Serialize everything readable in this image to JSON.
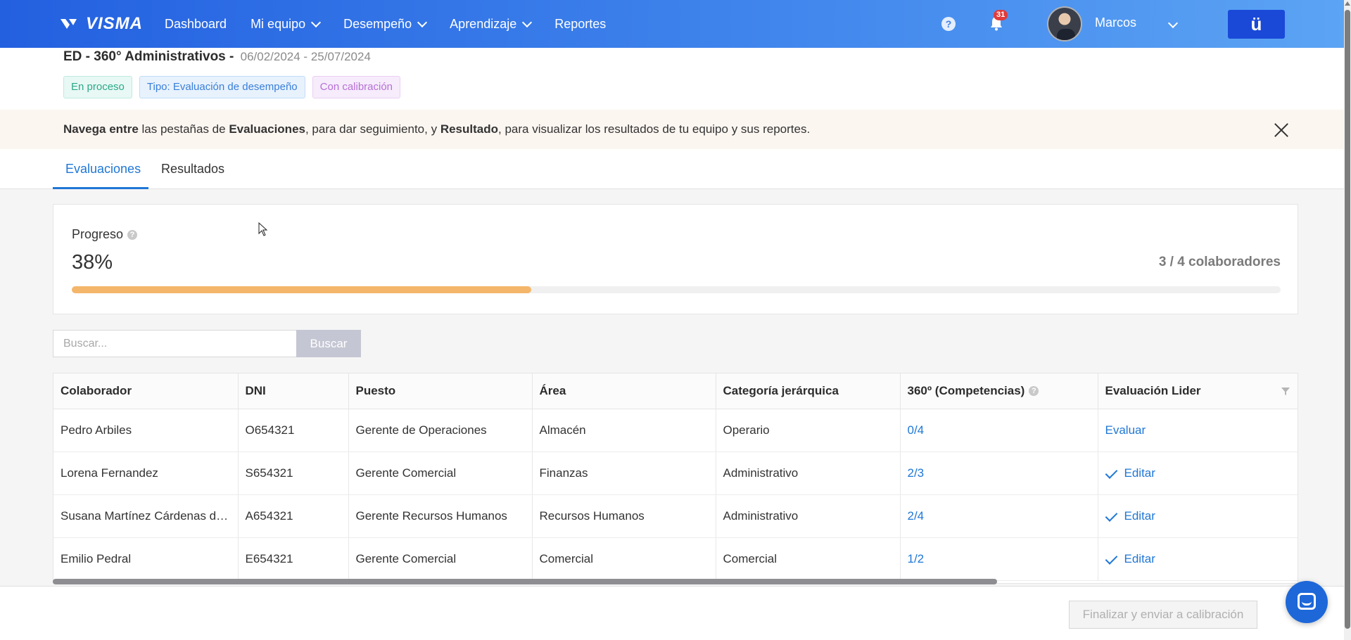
{
  "nav": {
    "logo": "VISMA",
    "items": [
      {
        "label": "Dashboard",
        "dropdown": false
      },
      {
        "label": "Mi equipo",
        "dropdown": true
      },
      {
        "label": "Desempeño",
        "dropdown": true
      },
      {
        "label": "Aprendizaje",
        "dropdown": true
      },
      {
        "label": "Reportes",
        "dropdown": false
      }
    ],
    "help_glyph": "?",
    "notification_count": "31",
    "user_name": "Marcos",
    "u_button": "ü",
    "accent_color": "#3f84ec"
  },
  "header": {
    "title": "ED - 360° Administrativos -",
    "dates": "06/02/2024 - 25/07/2024",
    "tags": [
      "En proceso",
      "Tipo: Evaluación de desempeño",
      "Con calibración"
    ]
  },
  "info": {
    "segments": [
      {
        "text": "Navega entre",
        "bold": true
      },
      {
        "text": " las pestañas de ",
        "bold": false
      },
      {
        "text": "Evaluaciones",
        "bold": true
      },
      {
        "text": ", para dar seguimiento, y ",
        "bold": false
      },
      {
        "text": "Resultado",
        "bold": true
      },
      {
        "text": ", para visualizar los resultados de tu equipo y sus reportes.",
        "bold": false
      }
    ]
  },
  "tabs": [
    "Evaluaciones",
    "Resultados"
  ],
  "progress": {
    "label": "Progreso",
    "value_text": "38%",
    "fraction": 0.38,
    "count_text": "3 / 4 colaboradores",
    "bar_color": "#f4b66b"
  },
  "search": {
    "placeholder": "Buscar...",
    "button": "Buscar"
  },
  "table": {
    "columns": [
      "Colaborador",
      "DNI",
      "Puesto",
      "Área",
      "Categoría jerárquica",
      "360º (Competencias)",
      "Evaluación Lider"
    ],
    "rows": [
      {
        "name": "Pedro Arbiles",
        "dni": "O654321",
        "puesto": "Gerente de Operaciones",
        "area": "Almacén",
        "categoria": "Operario",
        "competencias": "0/4",
        "lider": "Evaluar",
        "done": false
      },
      {
        "name": "Lorena Fernandez",
        "dni": "S654321",
        "puesto": "Gerente Comercial",
        "area": "Finanzas",
        "categoria": "Administrativo",
        "competencias": "2/3",
        "lider": "Editar",
        "done": true
      },
      {
        "name": "Susana Martínez Cárdenas de...",
        "dni": "A654321",
        "puesto": "Gerente Recursos Humanos",
        "area": "Recursos Humanos",
        "categoria": "Administrativo",
        "competencias": "2/4",
        "lider": "Editar",
        "done": true
      },
      {
        "name": "Emilio Pedral",
        "dni": "E654321",
        "puesto": "Gerente Comercial",
        "area": "Comercial",
        "categoria": "Comercial",
        "competencias": "1/2",
        "lider": "Editar",
        "done": true
      }
    ]
  },
  "footer": {
    "finalize_button": "Finalizar y enviar a calibración"
  }
}
